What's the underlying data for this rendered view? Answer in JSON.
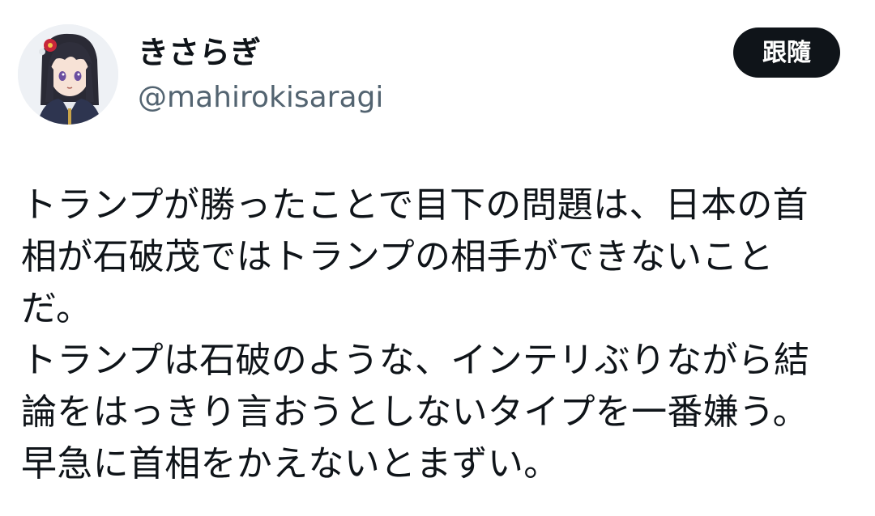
{
  "author": {
    "display_name": "きさらぎ",
    "handle": "@mahirokisaragi"
  },
  "follow_button_label": "跟隨",
  "tweet": {
    "lines": [
      "トランプが勝ったことで目下の問題は、日本の首",
      "相が石破茂ではトランプの相手ができないこと",
      "だ。",
      "トランプは石破のような、インテリぶりながら結",
      "論をはっきり言おうとしないタイプを一番嫌う。",
      "早急に首相をかえないとまずい。"
    ]
  },
  "colors": {
    "text_primary": "#0f1419",
    "text_secondary": "#536471",
    "button_bg": "#0f1419",
    "button_text": "#ffffff"
  },
  "icons": {
    "avatar": "anime-character-avatar"
  }
}
